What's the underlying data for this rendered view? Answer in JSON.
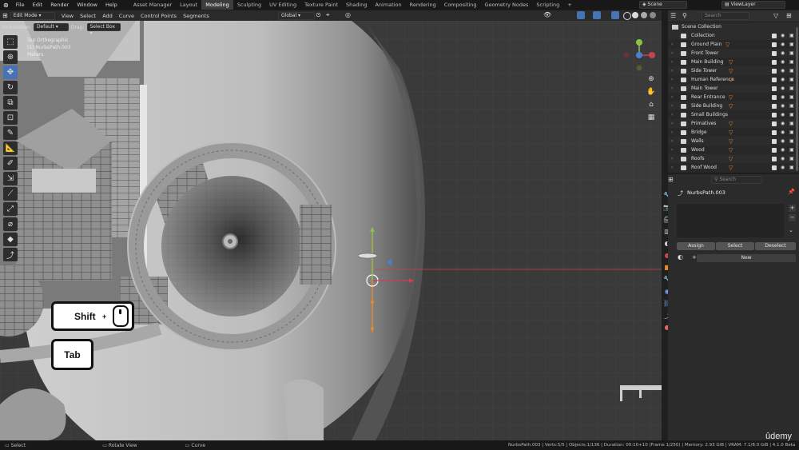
{
  "menu": {
    "items": [
      "File",
      "Edit",
      "Render",
      "Window",
      "Help"
    ],
    "workspaces": [
      "Asset Manager",
      "Layout",
      "Modeling",
      "Sculpting",
      "UV Editing",
      "Texture Paint",
      "Shading",
      "Animation",
      "Rendering",
      "Compositing",
      "Geometry Nodes",
      "Scripting"
    ],
    "active_workspace": "Modeling",
    "add_tab": "+",
    "scene": "Scene",
    "view_layer": "ViewLayer"
  },
  "header": {
    "mode": "Edit Mode",
    "items": [
      "View",
      "Select",
      "Add",
      "Curve",
      "Control Points",
      "Segments"
    ],
    "transform": "Global",
    "orientation_label": "Orientation:",
    "orientation_value": "Default",
    "drag_label": "Drag:",
    "drag_value": "Select Box"
  },
  "overlay_info": {
    "line1": "Top Orthographic",
    "line2": "(1) NurbsPath.003",
    "line3": "Meters"
  },
  "keys": {
    "shift": "Shift",
    "plus": "+",
    "tab": "Tab"
  },
  "outliner": {
    "search_placeholder": "Search",
    "root": "Scene Collection",
    "items": [
      {
        "label": "Collection"
      },
      {
        "label": "Ground Plain"
      },
      {
        "label": "Front Tower"
      },
      {
        "label": "Main Building"
      },
      {
        "label": "Side Tower"
      },
      {
        "label": "Human Reference"
      },
      {
        "label": "Main Tower"
      },
      {
        "label": "Rear Entrance"
      },
      {
        "label": "Side Building"
      },
      {
        "label": "Small Buildings"
      },
      {
        "label": "Primatives"
      },
      {
        "label": "Bridge"
      },
      {
        "label": "Walls"
      },
      {
        "label": "Wood"
      },
      {
        "label": "Roofs"
      },
      {
        "label": "Roof Wood"
      }
    ]
  },
  "properties": {
    "search_placeholder": "Search",
    "object_name": "NurbsPath.003",
    "assign": "Assign",
    "select": "Select",
    "deselect": "Deselect",
    "new_label": "New",
    "plus": "+",
    "minus": "−"
  },
  "status": {
    "select": "Select",
    "rotate": "Rotate View",
    "curve": "Curve",
    "stats": "NurbsPath.003 | Verts:5/5 | Objects:1/136 | Duration: 00:10+10 (Frame 1/250) | Memory: 2.93 GiB | VRAM: 7.1/8.0 GiB | 4.1.0 Beta"
  },
  "brand": "ûdemy",
  "colors": {
    "accent": "#4772b3",
    "active_tab": "#3d3d3d",
    "x_axis": "#c8424f",
    "orange": "#e8892f"
  }
}
